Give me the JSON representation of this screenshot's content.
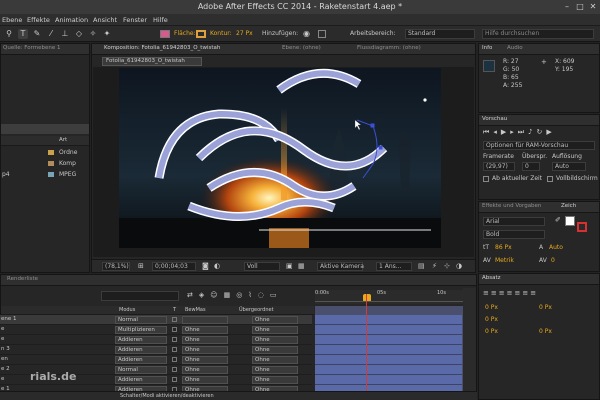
{
  "window": {
    "title": "Adobe After Effects CC 2014 - Raketenstart 4.aep *"
  },
  "menu": [
    "Ebene",
    "Effekte",
    "Animation",
    "Ansicht",
    "Fenster",
    "Hilfe"
  ],
  "toolbar": {
    "fill_label": "Fläche:",
    "stroke_label": "Kontur:",
    "stroke_width": "27 Px",
    "add_label": "Hinzufügen:",
    "workspace_label": "Arbeitsbereich:",
    "workspace_value": "Standard",
    "search_placeholder": "Hilfe durchsuchen",
    "fill_color": "#d85a8c",
    "stroke_color": "#e0a040"
  },
  "project": {
    "header": "Quelle: Formebene 1",
    "col_type": "Art",
    "items": [
      {
        "name": "",
        "type": "Ordne"
      },
      {
        "name": "",
        "type": "Komp"
      },
      {
        "name": "p4",
        "type": "MPEG"
      }
    ]
  },
  "composition": {
    "tabs": [
      "Komposition: Fotolia_61942803_O_twistah",
      "Ebene: (ohne)",
      "Flussdiagramm: (ohne)"
    ],
    "subtab": "Fotolia_61942803_O_twistah",
    "zoom": "(78,1%)",
    "timecode": "0;00;04;03",
    "resolution": "Voll",
    "camera": "Aktive Kamera",
    "views": "1 Ans..."
  },
  "info": {
    "tabs": [
      "Info",
      "Audio"
    ],
    "r": "R: 27",
    "g": "G: 50",
    "b": "B: 65",
    "a": "A: 255",
    "x": "X: 609",
    "y": "Y: 195"
  },
  "preview": {
    "title": "Vorschau",
    "mode": "Optionen für RAM-Vorschau",
    "framerate_label": "Framerate",
    "skip_label": "Überspr.",
    "resolution_label": "Auflösung",
    "framerate": "(29,97)",
    "skip": "0",
    "resolution": "Auto",
    "from_current": "Ab aktueller Zeit",
    "fullscreen": "Vollbildschirm"
  },
  "effects_panel": {
    "tabs": [
      "Effekte und Vorgaben",
      "Zeich"
    ],
    "font": "Arial",
    "style": "Bold",
    "size": "86 Px",
    "leading": "Auto",
    "kerning": "Metrik",
    "tracking": "0"
  },
  "paragraph": {
    "title": "Absatz",
    "v1": "0 Px",
    "v2": "0 Px",
    "v3": "0 Px",
    "v4": "0 Px",
    "v5": "0 Px"
  },
  "timeline": {
    "tab": "Renderliste",
    "col_mode": "Modus",
    "col_t": "T",
    "col_bewmas": "BewMas",
    "col_parent": "Übergeordnet",
    "ruler": [
      "0:00s",
      "05s",
      "10s"
    ],
    "footer": "Schalter/Modi aktivieren/deaktivieren",
    "layers": [
      {
        "name": "ene 1",
        "mode": "Normal",
        "bewmas": "",
        "parent": "Ohne"
      },
      {
        "name": "e",
        "mode": "Multiplizieren",
        "bewmas": "Ohne",
        "parent": "Ohne"
      },
      {
        "name": "e",
        "mode": "Addieren",
        "bewmas": "Ohne",
        "parent": "Ohne"
      },
      {
        "name": "n 3",
        "mode": "Addieren",
        "bewmas": "Ohne",
        "parent": "Ohne"
      },
      {
        "name": "en",
        "mode": "Addieren",
        "bewmas": "Ohne",
        "parent": "Ohne"
      },
      {
        "name": "e 2",
        "mode": "Normal",
        "bewmas": "Ohne",
        "parent": "Ohne"
      },
      {
        "name": "e",
        "mode": "Addieren",
        "bewmas": "Ohne",
        "parent": "Ohne"
      },
      {
        "name": "e 1",
        "mode": "Addieren",
        "bewmas": "Ohne",
        "parent": "Ohne"
      }
    ]
  },
  "watermark": "rials.de",
  "colors": {
    "track": "#5a6aa8",
    "playhead": "#d43a3a",
    "accent": "#e8a91e"
  }
}
